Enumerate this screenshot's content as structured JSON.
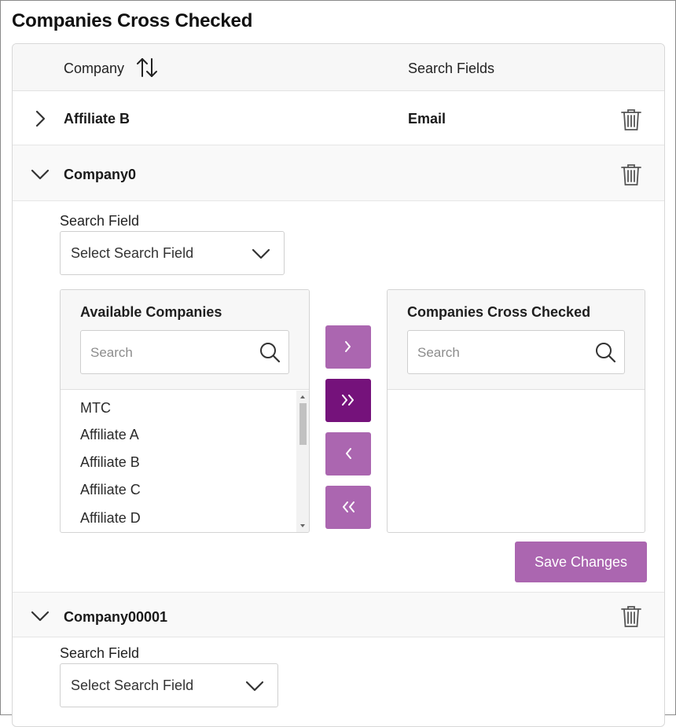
{
  "page": {
    "title": "Companies Cross Checked"
  },
  "grid": {
    "headers": {
      "company": "Company",
      "search_fields": "Search Fields"
    },
    "rows": [
      {
        "name": "Affiliate B",
        "search_field": "Email",
        "state": "collapsed"
      },
      {
        "name": "Company0",
        "search_field": "",
        "state": "expanded"
      },
      {
        "name": "Company00001",
        "search_field": "",
        "state": "expanded"
      }
    ]
  },
  "detail0": {
    "search_field_label": "Search Field",
    "select_placeholder": "Select Search Field",
    "available": {
      "title": "Available Companies",
      "search_placeholder": "Search",
      "items": [
        "MTC",
        "Affiliate A",
        "Affiliate B",
        "Affiliate C",
        "Affiliate D"
      ]
    },
    "checked": {
      "title": "Companies Cross Checked",
      "search_placeholder": "Search",
      "items": []
    },
    "transfer_buttons": [
      {
        "name": "move-selected-right",
        "icon": "chevron-right-icon"
      },
      {
        "name": "move-all-right",
        "icon": "double-chevron-right-icon"
      },
      {
        "name": "move-selected-left",
        "icon": "chevron-left-icon"
      },
      {
        "name": "move-all-left",
        "icon": "double-chevron-left-icon"
      }
    ],
    "save_label": "Save Changes"
  },
  "detail1": {
    "search_field_label": "Search Field",
    "select_placeholder": "Select Search Field"
  },
  "colors": {
    "accent": "#ab66b0",
    "accent_active": "#75127b",
    "header_bg": "#f7f7f7"
  }
}
